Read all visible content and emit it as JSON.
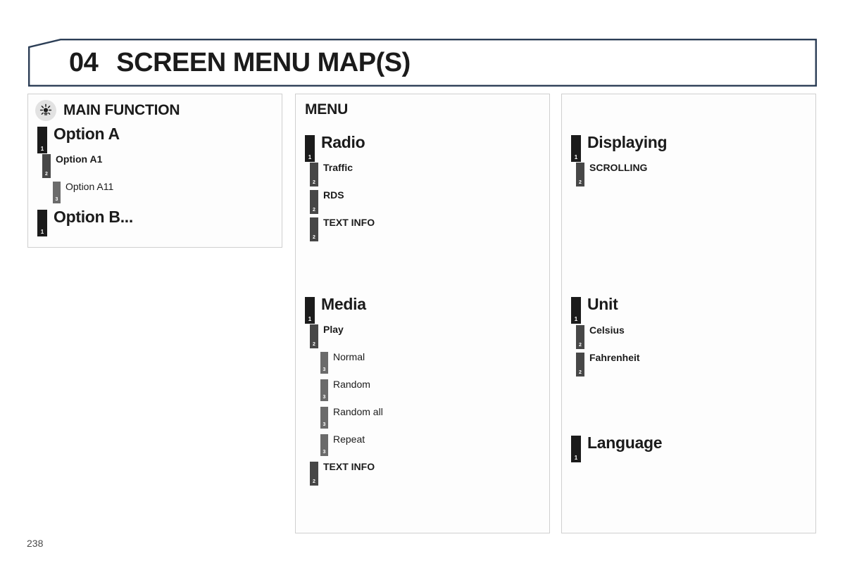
{
  "header": {
    "number": "04",
    "title": "SCREEN MENU MAP(S)",
    "border_color": "#2c3e56"
  },
  "legend_panel": {
    "icon": "sun-brightness-icon",
    "title": "MAIN FUNCTION",
    "items": [
      {
        "level": 1,
        "marker": "1",
        "label": "Option A"
      },
      {
        "level": 2,
        "marker": "2",
        "label": "Option A1"
      },
      {
        "level": 3,
        "marker": "3",
        "label": "Option A11"
      },
      {
        "level": 1,
        "marker": "1",
        "label": "Option B..."
      }
    ]
  },
  "menu_panel": {
    "heading": "MENU",
    "groups": [
      {
        "name": "radio-group",
        "items": [
          {
            "level": 1,
            "marker": "1",
            "label": "Radio"
          },
          {
            "level": 2,
            "marker": "2",
            "label": "Traffic"
          },
          {
            "level": 2,
            "marker": "2",
            "label": "RDS"
          },
          {
            "level": 2,
            "marker": "2",
            "label": "TEXT INFO"
          }
        ]
      },
      {
        "name": "media-group",
        "items": [
          {
            "level": 1,
            "marker": "1",
            "label": "Media"
          },
          {
            "level": 2,
            "marker": "2",
            "label": "Play"
          },
          {
            "level": 3,
            "marker": "3",
            "label": "Normal"
          },
          {
            "level": 3,
            "marker": "3",
            "label": "Random"
          },
          {
            "level": 3,
            "marker": "3",
            "label": "Random all"
          },
          {
            "level": 3,
            "marker": "3",
            "label": "Repeat"
          },
          {
            "level": 2,
            "marker": "2",
            "label": "TEXT INFO"
          }
        ]
      }
    ]
  },
  "settings_panel": {
    "heading": "",
    "groups": [
      {
        "name": "displaying-group",
        "items": [
          {
            "level": 1,
            "marker": "1",
            "label": "Displaying"
          },
          {
            "level": 2,
            "marker": "2",
            "label": "SCROLLING"
          }
        ]
      },
      {
        "name": "unit-group",
        "items": [
          {
            "level": 1,
            "marker": "1",
            "label": "Unit"
          },
          {
            "level": 2,
            "marker": "2",
            "label": "Celsius"
          },
          {
            "level": 2,
            "marker": "2",
            "label": "Fahrenheit"
          }
        ]
      },
      {
        "name": "language-group",
        "items": [
          {
            "level": 1,
            "marker": "1",
            "label": "Language"
          }
        ]
      }
    ]
  },
  "footer": {
    "page_number": "238"
  },
  "level_colors": {
    "level1": "#1b1b1b",
    "level2": "#474747",
    "level3": "#6b6b6b"
  }
}
